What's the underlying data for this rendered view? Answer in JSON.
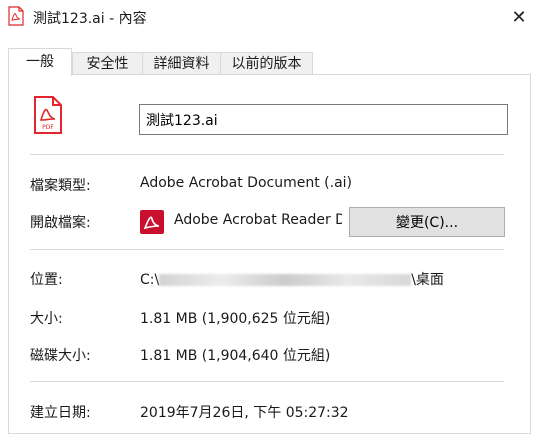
{
  "window": {
    "title": "測試123.ai - 內容",
    "close_glyph": "✕"
  },
  "tabs": [
    {
      "label": "一般",
      "active": true
    },
    {
      "label": "安全性",
      "active": false
    },
    {
      "label": "詳細資料",
      "active": false
    },
    {
      "label": "以前的版本",
      "active": false
    }
  ],
  "file": {
    "icon": "pdf-file-icon",
    "icon_text": "PDF",
    "name": "測試123.ai"
  },
  "properties": {
    "type_label": "檔案類型:",
    "type_value": "Adobe Acrobat Document (.ai)",
    "opens_with_label": "開啟檔案:",
    "opens_with_app": "Adobe Acrobat Reader DC",
    "change_button": "變更(C)...",
    "location_label": "位置:",
    "location_prefix": "C:\\",
    "location_suffix": "\\桌面",
    "size_label": "大小:",
    "size_value": "1.81 MB (1,900,625 位元組)",
    "disk_size_label": "磁碟大小:",
    "disk_size_value": "1.81 MB (1,904,640 位元組)",
    "created_label": "建立日期:",
    "created_value": "2019年7月26日, 下午 05:27:32"
  },
  "colors": {
    "pdf_red": "#e3262b",
    "acrobat_red": "#c8102e"
  }
}
